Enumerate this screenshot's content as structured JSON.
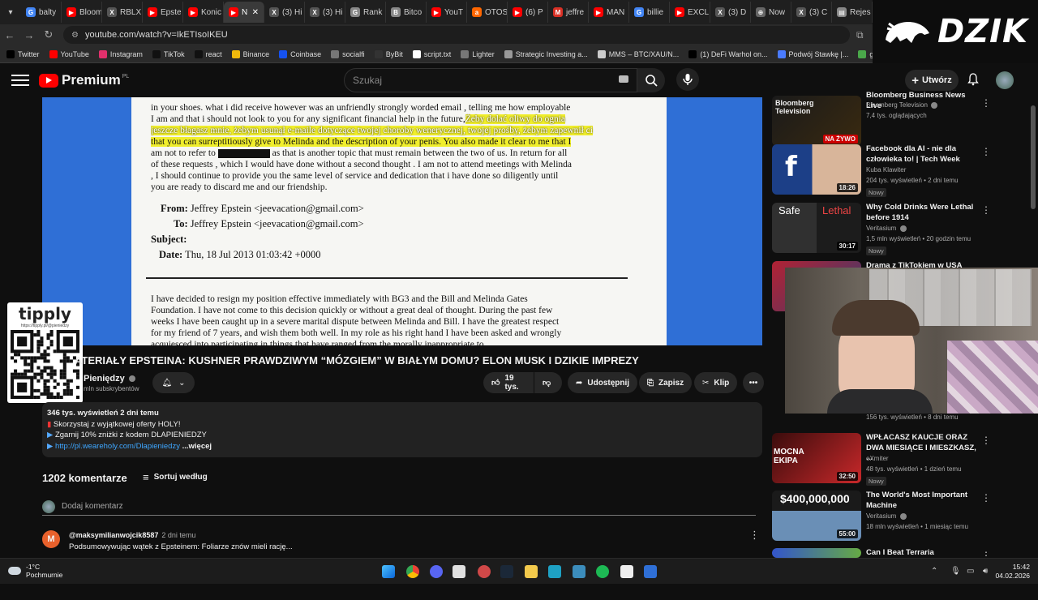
{
  "browser": {
    "tabs": [
      {
        "label": "balty",
        "color": "#4285f4",
        "glyph": "G"
      },
      {
        "label": "Bloom",
        "color": "#ff0000",
        "glyph": "▶"
      },
      {
        "label": "RBLX",
        "color": "#555555",
        "glyph": "X"
      },
      {
        "label": "Epste",
        "color": "#ff0000",
        "glyph": "▶"
      },
      {
        "label": "Konic",
        "color": "#ff0000",
        "glyph": "▶"
      },
      {
        "label": "N",
        "color": "#ff0000",
        "glyph": "▶",
        "active": true
      },
      {
        "label": "(3) Hi",
        "color": "#555555",
        "glyph": "X"
      },
      {
        "label": "(3) Hi",
        "color": "#555555",
        "glyph": "X"
      },
      {
        "label": "Rank",
        "color": "#888888",
        "glyph": "G"
      },
      {
        "label": "Bitco",
        "color": "#888888",
        "glyph": "B"
      },
      {
        "label": "YouT",
        "color": "#ff0000",
        "glyph": "▶"
      },
      {
        "label": "OTOS",
        "color": "#ff6600",
        "glyph": "a"
      },
      {
        "label": "(6) P",
        "color": "#ff0000",
        "glyph": "▶"
      },
      {
        "label": "jeffre",
        "color": "#d93025",
        "glyph": "M"
      },
      {
        "label": "MAN",
        "color": "#ff0000",
        "glyph": "▶"
      },
      {
        "label": "billie",
        "color": "#4285f4",
        "glyph": "G"
      },
      {
        "label": "EXCL",
        "color": "#ff0000",
        "glyph": "▶"
      },
      {
        "label": "(3) D",
        "color": "#555555",
        "glyph": "X"
      },
      {
        "label": "Now",
        "color": "#666666",
        "glyph": "⊕"
      },
      {
        "label": "(3) C",
        "color": "#555555",
        "glyph": "X"
      },
      {
        "label": "Rejes",
        "color": "#888888",
        "glyph": "▤"
      }
    ],
    "url": "youtube.com/watch?v=IkETIsoIKEU",
    "bookmarks": [
      {
        "label": "Twitter",
        "color": "#000000"
      },
      {
        "label": "YouTube",
        "color": "#ff0000"
      },
      {
        "label": "Instagram",
        "color": "#e1306c"
      },
      {
        "label": "TikTok",
        "color": "#111111"
      },
      {
        "label": "react",
        "color": "#111111"
      },
      {
        "label": "Binance",
        "color": "#f0b90b"
      },
      {
        "label": "Coinbase",
        "color": "#1652f0"
      },
      {
        "label": "socialfi",
        "color": "#777777"
      },
      {
        "label": "ByBit",
        "color": "#333333"
      },
      {
        "label": "script.txt",
        "color": "#ffffff"
      },
      {
        "label": "Lighter",
        "color": "#777777"
      },
      {
        "label": "Strategic Investing a...",
        "color": "#999999"
      },
      {
        "label": "MMS – BTC/XAU/N...",
        "color": "#cccccc"
      },
      {
        "label": "(1) DeFi Warhol on...",
        "color": "#000000"
      },
      {
        "label": "Podwój Stawkę |...",
        "color": "#4a7bff"
      },
      {
        "label": "gierki robloxowe do...",
        "color": "#4aa84a"
      },
      {
        "label": "Calendar | Forex Fac...",
        "color": "#555555"
      }
    ]
  },
  "overlay": {
    "logo_text": "DZIK"
  },
  "youtube": {
    "brand": "Premium",
    "region": "PL",
    "search_placeholder": "Szukaj",
    "create_label": "Utwórz"
  },
  "video": {
    "document_lines": [
      {
        "text": "in your shoes. what i did receive however was an unfriendly strongly worded email , telling me how employable",
        "hl": ""
      },
      {
        "text": "I am and that i should not look to you for any significant  financial help in the future,",
        "hl": "Żeby dolać oliwy do ognia"
      },
      {
        "text": "",
        "hl": "jeszcze błagasz mnie, żebym usunął e-maile dotyczące twojej choroby wenerycznej, twojej prośby, żebym zapewnił ci"
      },
      {
        "text": "",
        "hl": "that you can surreptitiously give to Melinda and the description of your penis. You also  made it clear to me that I"
      },
      {
        "text": "am not to refer to [REDACTED] as that is another topic that must remain between the two of us.  In return for all",
        "hl": ""
      },
      {
        "text": "of these requests , which I would have done without a second thought . I am not to attend meetings with Melinda",
        "hl": ""
      },
      {
        "text": ", I should continue to provide you the same level of service and dedication that i have done so diligently until",
        "hl": ""
      },
      {
        "text": "you are ready to discard me and our friendship.",
        "hl": ""
      }
    ],
    "from_label": "From:",
    "from_value": "Jeffrey Epstein <jeevacation@gmail.com>",
    "to_label": "To:",
    "to_value": "Jeffrey Epstein <jeevacation@gmail.com>",
    "subject_label": "Subject:",
    "date_label": "Date:",
    "date_value": "Thu, 18 Jul 2013 01:03:42 +0000",
    "body_lines": [
      "I have decided to resign my position  effective immediately with BG3   and the Bill and Melinda Gates",
      "Foundation.  I have not come to this decision quickly or without a great deal of thought.  During the past few",
      "weeks  I have been caught up in a severe marital dispute between Melinda and Bill.  I have the greatest respect",
      "for my friend of 7 years, and wish them both well. In my role as his right hand I have been asked and wrongly",
      "acquiesced  into participating  in things that have ranged from the morally inappropriate to",
      "unsound and..."
    ],
    "title": "ATERIAŁY EPSTEINA: KUSHNER PRAWDZIWYM “MÓZGIEM” W BIAŁYM DOMU? ELON MUSK I DZIKIE IMPREZY",
    "channel": "Pieniędzy",
    "subs": "mln subskrybentów",
    "likes": "19 tys.",
    "share": "Udostępnij",
    "save": "Zapisz",
    "clip": "Klip"
  },
  "tipply": {
    "logo": "tipply",
    "url": "https://tipply.pl/@pieniedzy"
  },
  "description": {
    "stats": "346 tys. wyświetleń  2 dni temu",
    "line1": "Skorzystaj z wyjątkowej oferty HOLY!",
    "line2": "Zgarnij 10% zniżki z kodem DLAPIENIEDZY",
    "link": "http://pl.weareholy.com/Dlapieniedzy",
    "more": "...więcej"
  },
  "comments": {
    "count": "1202 komentarze",
    "sort": "Sortuj według",
    "add_placeholder": "Dodaj komentarz",
    "first": {
      "initial": "M",
      "user": "@maksymilianwojcik8587",
      "date": "2 dni temu",
      "text": "Podsumowywując wątek z Epsteinem: Foliarze znów mieli rację..."
    }
  },
  "sidebar": [
    {
      "title": "Bloomberg Business News Live",
      "channel": "Bloomberg Television",
      "meta": "7,4 tys. oglądających",
      "duration": "",
      "live": "NA ŻYWO",
      "new": "",
      "thumb": "bloomberg"
    },
    {
      "title": "Facebook dla AI - nie dla człowieka to! | Tech Week",
      "channel": "Kuba Klawiter",
      "meta": "204 tys. wyświetleń • 2 dni temu",
      "duration": "18:26",
      "live": "",
      "new": "Nowy",
      "thumb": "facebook"
    },
    {
      "title": "Why Cold Drinks Were Lethal before 1914",
      "channel": "Veritasium",
      "meta": "1,5 mln wyświetleń • 20 godzin temu",
      "duration": "30:17",
      "live": "",
      "new": "Nowy",
      "thumb": "safe"
    },
    {
      "title": "Drama z TikTokiem w USA",
      "channel": "",
      "meta": "156 tys. wyświetleń • 8 dni temu",
      "duration": "28:25",
      "live": "",
      "new": "",
      "thumb": "tiktok"
    },
    {
      "title": "WPŁACASZ KAUCJE ORAZ DWA MIESIĄCE I MIESZKASZ, ...",
      "channel": "eXmiter",
      "meta": "48 tys. wyświetleń • 1 dzień temu",
      "duration": "32:50",
      "live": "",
      "new": "Nowy",
      "thumb": "ekipa"
    },
    {
      "title": "The World's Most Important Machine",
      "channel": "Veritasium",
      "meta": "18 mln wyświetleń • 1 miesiąc temu",
      "duration": "55:00",
      "live": "",
      "new": "",
      "thumb": "machine"
    },
    {
      "title": "Can I Beat Terraria HARDCORE",
      "channel": "",
      "meta": "",
      "duration": "",
      "live": "",
      "new": "",
      "thumb": "terraria"
    }
  ],
  "thumb_text": {
    "bloomberg": "Bloomberg Television",
    "safe": "Safe",
    "lethal": "Lethal",
    "ekipa": "MOCNA EKIPA",
    "machine": "$400,000,000"
  },
  "taskbar": {
    "temp": "-1°C",
    "weather": "Pochmurnie",
    "time": "15:42",
    "date": "04.02.2026"
  }
}
